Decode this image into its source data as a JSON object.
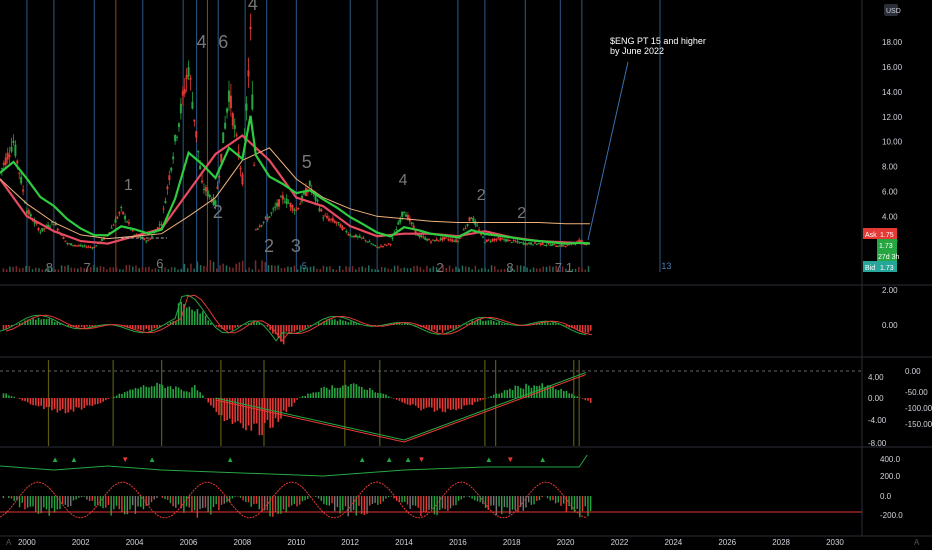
{
  "currency": "USD",
  "corner_labels": {
    "left": "A",
    "right": "A"
  },
  "annotation": {
    "line1": "$ENG PT 15 and higher",
    "line2": "by June 2022"
  },
  "years": [
    "2000",
    "2002",
    "2004",
    "2006",
    "2008",
    "2010",
    "2012",
    "2014",
    "2016",
    "2018",
    "2020",
    "2022",
    "2024",
    "2026",
    "2028",
    "2030"
  ],
  "price_axis": [
    "18.00",
    "16.00",
    "14.00",
    "12.00",
    "10.00",
    "8.00",
    "6.00",
    "4.00",
    "2.00"
  ],
  "price_tags": {
    "ask_label": "Ask",
    "ask": "1.75",
    "last": "1.73",
    "countdown": "27d 3h",
    "bid_label": "Bid",
    "bid": "1.73"
  },
  "vline_labels": [
    "5",
    "13"
  ],
  "pane2_axis": [
    "2.00",
    "0.00"
  ],
  "pane3_axis_left": [
    "4.00",
    "0.00",
    "-4.00",
    "-8.00"
  ],
  "pane3_axis_right": [
    "0.00",
    "-50.00",
    "-100.00",
    "-150.00"
  ],
  "pane4_axis": [
    "400.0",
    "200.0",
    "0.0",
    "-200.0"
  ],
  "wave_labels": [
    {
      "t": "4",
      "size": "large"
    },
    {
      "t": "6",
      "size": "large"
    },
    {
      "t": "4",
      "size": "large"
    },
    {
      "t": "5",
      "size": "large"
    },
    {
      "t": "4",
      "size": "med"
    },
    {
      "t": "2",
      "size": "med"
    },
    {
      "t": "2",
      "size": "med"
    },
    {
      "t": "1",
      "size": "med"
    },
    {
      "t": "2",
      "size": "large"
    },
    {
      "t": "2",
      "size": "large"
    },
    {
      "t": "3",
      "size": "large"
    },
    {
      "t": "8",
      "size": "small"
    },
    {
      "t": "7",
      "size": "small"
    },
    {
      "t": "6",
      "size": "small"
    },
    {
      "t": "2",
      "size": "small"
    },
    {
      "t": "8",
      "size": "small"
    },
    {
      "t": "7",
      "size": "small"
    },
    {
      "t": "1",
      "size": "small"
    }
  ],
  "colors": {
    "bull": "#26a641",
    "bear": "#e53935",
    "ema_fast": "#2ecc40",
    "ema_slow": "#e84a5f",
    "ma_long": "#f0b27a",
    "cycle_blue": "#2a5a8a",
    "cycle_orange": "#8a4a1a",
    "ask_bg": "#e53935",
    "bid_bg": "#26a69a"
  },
  "chart_data": {
    "type": "line",
    "title": "",
    "xlabel": "",
    "ylabel": "",
    "x_range": [
      "1999",
      "2031"
    ],
    "ylim": [
      0,
      19
    ],
    "series": [
      {
        "x": [
          1999.0,
          1999.5,
          2000.0,
          2000.5,
          2001.0,
          2001.5,
          2002.0,
          2002.5,
          2003.0,
          2003.5,
          2004.0,
          2004.5,
          2005.0,
          2005.5,
          2006.0,
          2006.5,
          2007.0,
          2007.5,
          2008.0,
          2008.3,
          2008.5,
          2009.0,
          2009.5,
          2010.0,
          2010.5,
          2011.0,
          2011.5,
          2012.0,
          2012.5,
          2013.0,
          2013.5,
          2014.0,
          2014.5,
          2015.0,
          2015.5,
          2016.0,
          2016.5,
          2017.0,
          2017.5,
          2018.0,
          2018.5,
          2019.0,
          2019.5,
          2020.0,
          2020.5,
          2020.9
        ],
        "values": [
          7.5,
          10.0,
          4.5,
          2.8,
          3.5,
          1.8,
          1.6,
          1.5,
          2.5,
          4.5,
          2.5,
          2.0,
          3.5,
          10.0,
          16.0,
          6.5,
          5.0,
          14.0,
          7.0,
          18.5,
          3.0,
          4.0,
          5.5,
          4.5,
          6.5,
          4.0,
          3.5,
          2.5,
          2.2,
          1.5,
          1.8,
          4.5,
          2.5,
          2.0,
          2.2,
          2.0,
          4.0,
          2.0,
          2.2,
          2.0,
          1.8,
          1.8,
          1.7,
          1.6,
          2.0,
          1.73
        ]
      },
      {
        "name": "",
        "x": [
          1999.0,
          2000.0,
          2001.0,
          2002.0,
          2003.0,
          2004.0,
          2005.0,
          2006.0,
          2007.0,
          2008.0,
          2009.0,
          2010.0,
          2011.0,
          2012.0,
          2013.0,
          2014.0,
          2015.0,
          2016.0,
          2017.0,
          2018.0,
          2019.0,
          2020.0,
          2020.9
        ],
        "values": [
          7.0,
          4.0,
          2.8,
          2.0,
          1.8,
          2.4,
          3.0,
          6.0,
          9.0,
          10.5,
          8.5,
          5.5,
          4.8,
          3.2,
          2.4,
          2.6,
          2.6,
          2.4,
          2.8,
          2.3,
          2.0,
          1.9,
          1.8
        ]
      },
      {
        "name": "",
        "x": [
          1999.0,
          2000.0,
          2001.0,
          2002.0,
          2003.0,
          2004.0,
          2005.0,
          2006.0,
          2007.0,
          2008.0,
          2009.0,
          2010.0,
          2011.0,
          2012.0,
          2013.0,
          2014.0,
          2015.0,
          2016.0,
          2017.0,
          2018.0,
          2019.0,
          2020.0,
          2020.9
        ],
        "values": [
          7.0,
          5.0,
          3.5,
          2.5,
          2.2,
          2.4,
          2.6,
          4.0,
          5.5,
          8.5,
          9.5,
          7.0,
          5.5,
          4.6,
          4.0,
          3.8,
          3.6,
          3.5,
          3.5,
          3.5,
          3.5,
          3.4,
          3.4
        ]
      }
    ]
  }
}
